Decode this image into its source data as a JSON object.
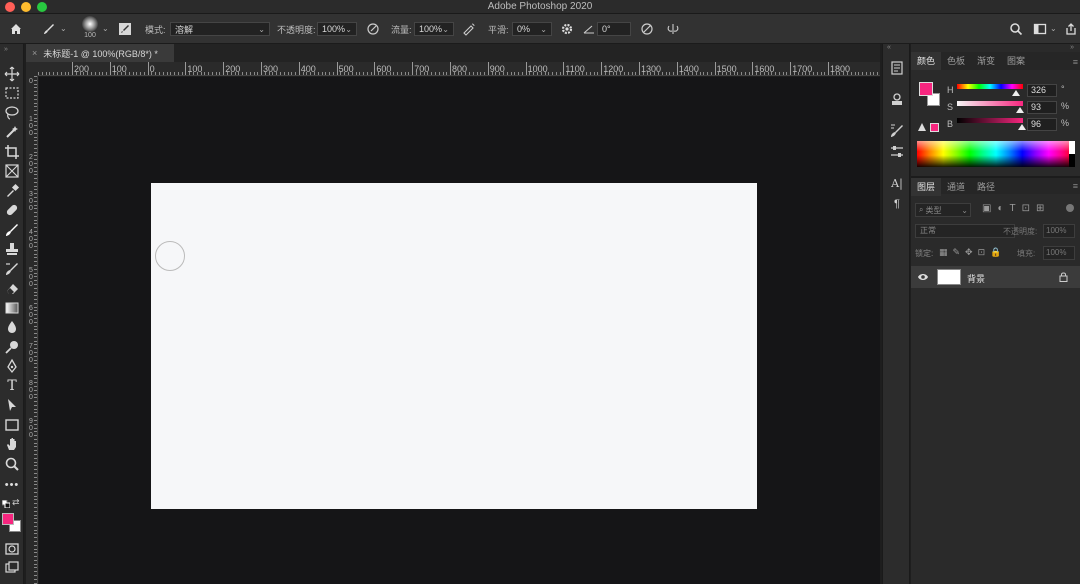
{
  "app": {
    "title": "Adobe Photoshop 2020"
  },
  "traffic_lights": {
    "close": "#ff5f57",
    "minimize": "#febc2e",
    "zoom": "#28c840"
  },
  "options": {
    "brush_size": "100",
    "mode_label": "模式:",
    "mode_value": "溶解",
    "opacity_label": "不透明度:",
    "opacity_value": "100%",
    "flow_label": "流量:",
    "flow_value": "100%",
    "smooth_label": "平滑:",
    "smooth_value": "0%",
    "angle_value": "0°"
  },
  "document": {
    "tab_title": "未标题-1 @ 100%(RGB/8*) *",
    "close_glyph": "×"
  },
  "ruler": {
    "top_labels": [
      "200",
      "100",
      "0",
      "100",
      "200",
      "300",
      "400",
      "500",
      "600",
      "700",
      "800",
      "900",
      "1000",
      "1100",
      "1200",
      "1300",
      "1400",
      "1500",
      "1600",
      "1700",
      "1800"
    ],
    "left_labels": [
      "0",
      "1 0 0",
      "2 0 0",
      "3 0 0",
      "4 0 0",
      "5 0 0",
      "6 0 0",
      "7 0 0",
      "8 0 0",
      "9 0 0"
    ]
  },
  "colors": {
    "foreground": "#f7267f",
    "background": "#ffffff",
    "canvas": "#f6f7f9",
    "workspace": "#151517"
  },
  "color_panel": {
    "tabs": [
      "颜色",
      "色板",
      "渐变",
      "图案"
    ],
    "h_label": "H",
    "h_value": "326",
    "h_unit": "°",
    "s_label": "S",
    "s_value": "93",
    "s_unit": "%",
    "b_label": "B",
    "b_value": "96",
    "b_unit": "%"
  },
  "layers_panel": {
    "tabs": [
      "图层",
      "通道",
      "路径"
    ],
    "filter_label": "类型",
    "blend_mode": "正常",
    "opacity_label": "不透明度:",
    "opacity_value": "100%",
    "lock_label": "锁定:",
    "fill_label": "填充:",
    "fill_value": "100%",
    "layers": [
      {
        "name": "背景",
        "visible": true,
        "locked": true
      }
    ]
  },
  "icons": [
    "home-icon",
    "brush-icon",
    "search-icon",
    "workspace-icon",
    "share-icon"
  ]
}
